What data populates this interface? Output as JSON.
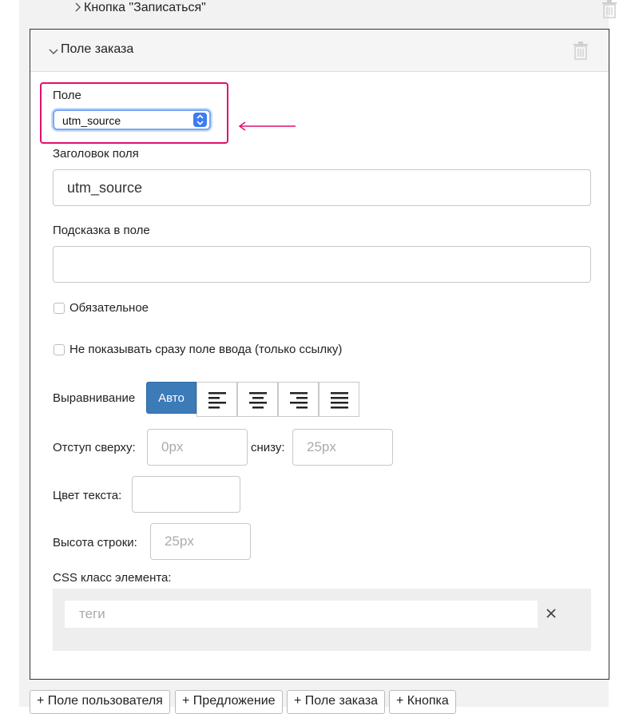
{
  "collapsed_section": {
    "title": "Кнопка \"Записаться\""
  },
  "panel": {
    "title": "Поле заказа",
    "field": {
      "label": "Поле",
      "selected": "utm_source"
    },
    "field_title": {
      "label": "Заголовок поля",
      "value": "utm_source"
    },
    "field_hint": {
      "label": "Подсказка в поле",
      "value": ""
    },
    "required": {
      "label": "Обязательное",
      "checked": false
    },
    "hide_input": {
      "label": "Не показывать сразу поле ввода (только ссылку)",
      "checked": false
    },
    "alignment": {
      "label": "Выравнивание",
      "auto_label": "Авто",
      "icons": [
        "align-left-icon",
        "align-center-icon",
        "align-right-icon",
        "align-justify-icon"
      ],
      "selected": "Авто"
    },
    "margin": {
      "top_label": "Отступ сверху:",
      "top_placeholder": "0px",
      "bottom_label": "снизу:",
      "bottom_placeholder": "25px"
    },
    "text_color": {
      "label": "Цвет текста:",
      "value": ""
    },
    "line_height": {
      "label": "Высота строки:",
      "placeholder": "25px"
    },
    "css_class": {
      "label": "CSS класс элемента:",
      "tags_placeholder": "теги",
      "clear_icon": "close-icon"
    }
  },
  "bottom_buttons": [
    "+ Поле пользователя",
    "+ Предложение",
    "+ Поле заказа",
    "+ Кнопка"
  ],
  "colors": {
    "highlight": "#e0116f",
    "active_button": "#3d7ab8",
    "select_focus": "#7aa7f2"
  }
}
